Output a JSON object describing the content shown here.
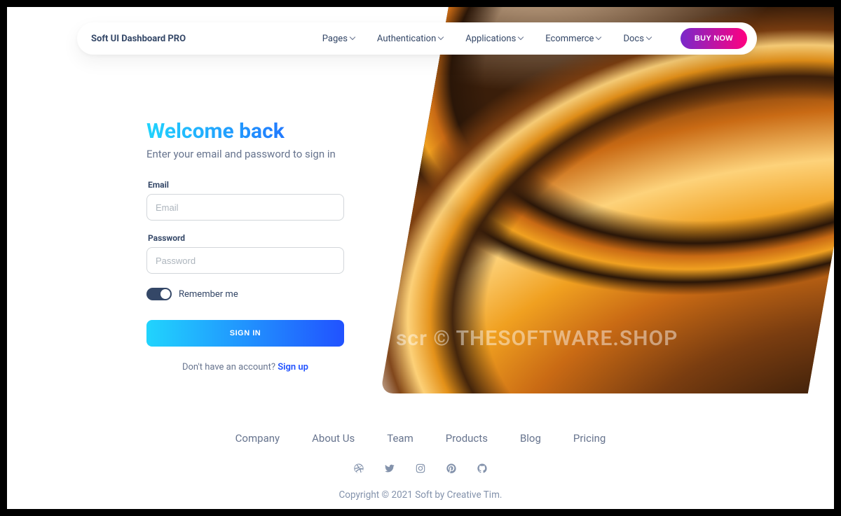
{
  "navbar": {
    "brand": "Soft UI Dashboard PRO",
    "links": [
      "Pages",
      "Authentication",
      "Applications",
      "Ecommerce",
      "Docs"
    ],
    "buy": "BUY NOW"
  },
  "signin": {
    "title": "Welcome back",
    "subtitle": "Enter your email and password to sign in",
    "email_label": "Email",
    "email_placeholder": "Email",
    "password_label": "Password",
    "password_placeholder": "Password",
    "remember_label": "Remember me",
    "submit": "SIGN IN",
    "no_account": "Don't have an account? ",
    "signup": "Sign up"
  },
  "footer": {
    "links": [
      "Company",
      "About Us",
      "Team",
      "Products",
      "Blog",
      "Pricing"
    ],
    "icons": [
      "dribbble-icon",
      "twitter-icon",
      "instagram-icon",
      "pinterest-icon",
      "github-icon"
    ],
    "copyright": "Copyright © 2021 Soft by Creative Tim."
  },
  "watermark": "scr © THESOFTWARE.SHOP"
}
